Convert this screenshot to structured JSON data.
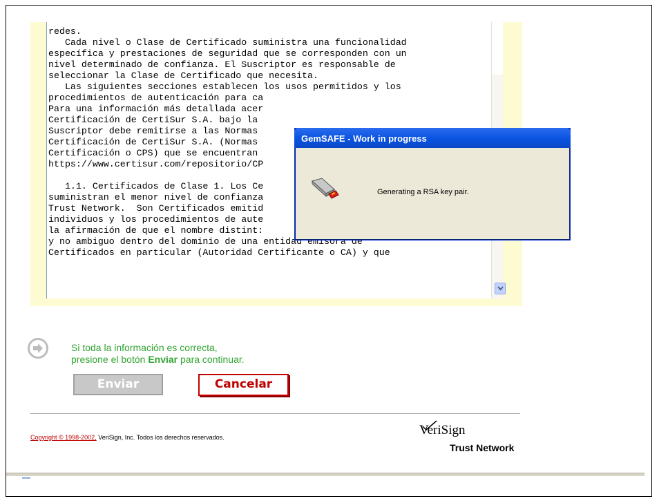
{
  "license": {
    "text_lines": [
      "redes.",
      "   Cada nivel o Clase de Certificado suministra una funcionalidad",
      "específica y prestaciones de seguridad que se corresponden con un",
      "nivel determinado de confianza. El Suscriptor es responsable de",
      "seleccionar la Clase de Certificado que necesita.",
      "   Las siguientes secciones establecen los usos permitidos y los",
      "procedimientos de autenticación para ca",
      "Para una información más detallada acer",
      "Certificación de CertiSur S.A. bajo la",
      "Suscriptor debe remitirse a las Normas",
      "Certificación de CertiSur S.A. (Normas",
      "Certificación o CPS) que se encuentran",
      "https://www.certisur.com/repositorio/CP",
      "",
      "   1.1. Certificados de Clase 1. Los Ce",
      "suministran el menor nivel de confianza",
      "Trust Network.  Son Certificados emitid",
      "individuos y los procedimientos de aute",
      "la afirmación de que el nombre distint:",
      "y no ambiguo dentro del dominio de una entidad emisora de",
      "Certificados en particular (Autoridad Certificante o CA) y que"
    ]
  },
  "dialog": {
    "title": "GemSAFE - Work in progress",
    "message": "Generating a RSA key pair.",
    "icon": "smartcard-reader-icon"
  },
  "action": {
    "line1": "Si toda la información es correcta,",
    "line2_prefix": "presione el botón ",
    "line2_bold": "Enviar",
    "line2_suffix": " para continuar.",
    "send_label": "Enviar",
    "cancel_label": "Cancelar"
  },
  "footer": {
    "copyright_link": "Copyright © 1998-2002,",
    "copyright_rest": " VeriSign, Inc. Todos los derechos reservados.",
    "logo_brand": "VeriSign",
    "logo_tagline": "Trust Network"
  },
  "colors": {
    "panel_bg": "#fdfbd1",
    "instruction_green": "#31a431",
    "cancel_red": "#c00000",
    "dialog_title_blue": "#0a53e0",
    "dialog_bg": "#ece9d8"
  }
}
